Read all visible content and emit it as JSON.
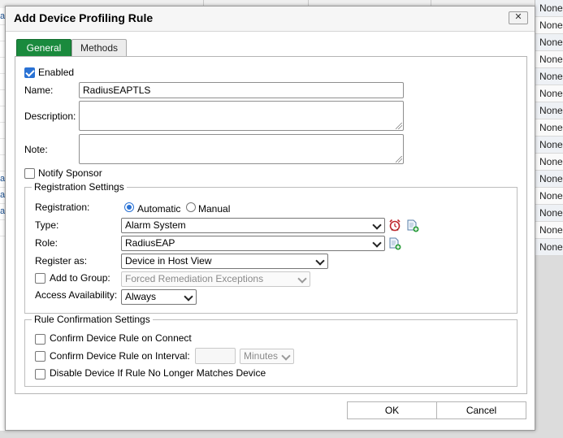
{
  "background": {
    "right_column": [
      "None",
      "None",
      "None",
      "None",
      "None",
      "None",
      "None",
      "None",
      "None",
      "None",
      "None",
      "None",
      "None",
      "None",
      "None"
    ],
    "left_column": [
      "at",
      "",
      "",
      "",
      "",
      "",
      "",
      "",
      "",
      "",
      "at",
      "at",
      "at",
      ""
    ]
  },
  "dialog": {
    "title": "Add Device Profiling Rule",
    "close_glyph": "✕",
    "tabs": [
      {
        "label": "General",
        "active": true
      },
      {
        "label": "Methods",
        "active": false
      }
    ],
    "enabled": {
      "label": "Enabled",
      "checked": true
    },
    "name": {
      "label": "Name:",
      "value": "RadiusEAPTLS"
    },
    "description": {
      "label": "Description:",
      "value": ""
    },
    "note": {
      "label": "Note:",
      "value": ""
    },
    "notify_sponsor": {
      "label": "Notify Sponsor",
      "checked": false
    },
    "registration_settings": {
      "legend": "Registration Settings",
      "registration_label": "Registration:",
      "automatic_label": "Automatic",
      "manual_label": "Manual",
      "selected": "Automatic",
      "type_label": "Type:",
      "type_value": "Alarm System",
      "role_label": "Role:",
      "role_value": "RadiusEAP",
      "register_as_label": "Register as:",
      "register_as_value": "Device in Host View",
      "add_to_group_label": "Add to Group:",
      "add_to_group_checked": false,
      "add_to_group_value": "Forced Remediation Exceptions",
      "access_availability_label": "Access Availability:",
      "access_availability_value": "Always"
    },
    "rule_confirmation": {
      "legend": "Rule Confirmation Settings",
      "confirm_on_connect": "Confirm Device Rule on Connect",
      "confirm_on_interval": "Confirm Device Rule on Interval:",
      "interval_value": "",
      "interval_unit": "Minutes",
      "disable_if_no_match": "Disable Device If Rule No Longer Matches Device"
    },
    "buttons": {
      "ok": "OK",
      "cancel": "Cancel"
    },
    "icons": {
      "type_icon": "alarm-clock-icon",
      "type_add": "add-document-icon",
      "role_add": "add-document-icon",
      "alarm_color": "#c0272d",
      "add_color": "#2e9e3e"
    },
    "accent_color": "#1a8a3d"
  }
}
